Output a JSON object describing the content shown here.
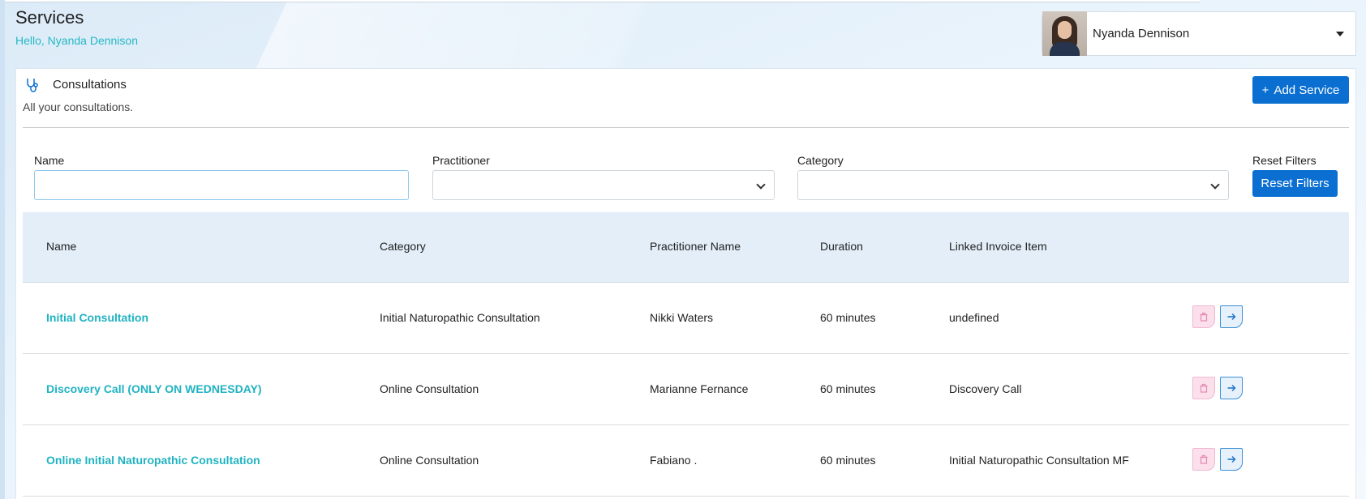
{
  "header": {
    "title": "Services",
    "greeting": "Hello, Nyanda Dennison"
  },
  "user_menu": {
    "name": "Nyanda Dennison"
  },
  "section": {
    "icon": "stethoscope-icon",
    "title": "Consultations",
    "subtitle": "All your consultations.",
    "add_button": "Add Service"
  },
  "filters": {
    "name_label": "Name",
    "name_value": "",
    "practitioner_label": "Practitioner",
    "practitioner_value": "",
    "category_label": "Category",
    "category_value": "",
    "reset_label": "Reset Filters",
    "reset_button": "Reset Filters"
  },
  "table": {
    "columns": [
      "Name",
      "Category",
      "Practitioner Name",
      "Duration",
      "Linked Invoice Item"
    ],
    "rows": [
      {
        "name": "Initial Consultation",
        "category": "Initial Naturopathic Consultation",
        "practitioner": "Nikki Waters",
        "duration": "60 minutes",
        "invoice_item": "undefined"
      },
      {
        "name": "Discovery Call (ONLY ON WEDNESDAY)",
        "category": "Online Consultation",
        "practitioner": "Marianne Fernance",
        "duration": "60 minutes",
        "invoice_item": "Discovery Call"
      },
      {
        "name": "Online Initial Naturopathic Consultation",
        "category": "Online Consultation",
        "practitioner": "Fabiano .",
        "duration": "60 minutes",
        "invoice_item": "Initial Naturopathic Consultation MF"
      }
    ]
  },
  "colors": {
    "primary": "#0a6fd1",
    "link": "#1fb3c2",
    "table_header_bg": "#e3eef8",
    "delete_bg": "#fbe0ec"
  }
}
